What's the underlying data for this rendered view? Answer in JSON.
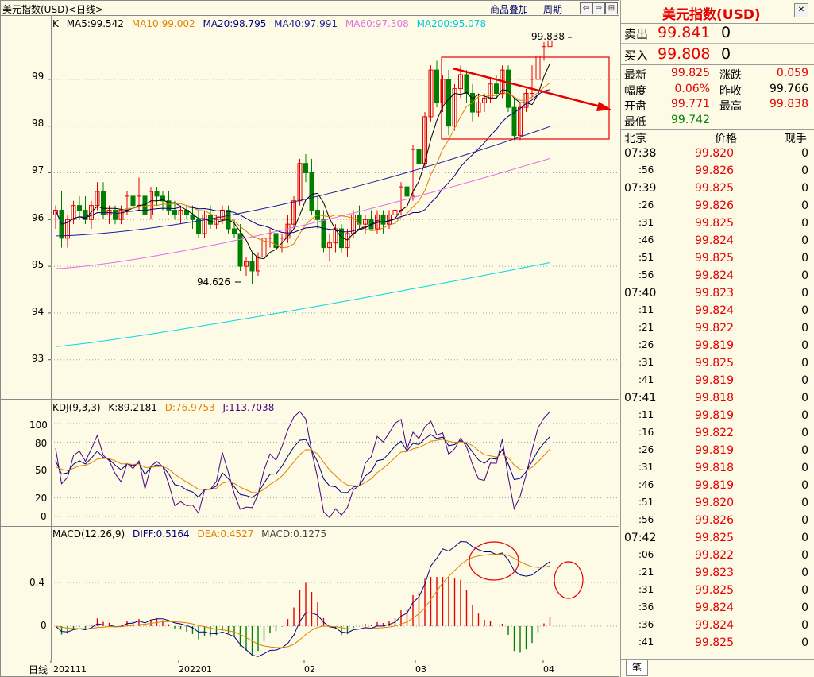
{
  "header": {
    "title": "美元指数(USD)<日线>",
    "links": {
      "overlay": "商品叠加",
      "period": "周期"
    }
  },
  "main_legend": {
    "k": "K",
    "ma5": "MA5:99.542",
    "ma10": "MA10:99.002",
    "ma20": "MA20:98.795",
    "ma40": "MA40:97.991",
    "ma60": "MA60:97.308",
    "ma200": "MA200:95.078"
  },
  "price_axis": [
    "99",
    "98",
    "97",
    "96",
    "95",
    "94",
    "93"
  ],
  "annotations": {
    "high": "99.838",
    "low": "94.626"
  },
  "kdj_legend": {
    "name": "KDJ(9,3,3)",
    "k": "K:89.2181",
    "d": "D:76.9753",
    "j": "J:113.7038"
  },
  "kdj_axis": [
    "100",
    "80",
    "50",
    "20",
    "0"
  ],
  "macd_legend": {
    "name": "MACD(12,26,9)",
    "diff": "DIFF:0.5164",
    "dea": "DEA:0.4527",
    "macd": "MACD:0.1275"
  },
  "macd_axis": [
    "0.4",
    "0"
  ],
  "x_axis": {
    "period_label": "日线",
    "ticks": [
      "202111",
      "202201",
      "02",
      "03",
      "04"
    ]
  },
  "side": {
    "title": "美元指数(USD)",
    "sell": {
      "label": "卖出",
      "price": "99.841",
      "vol": "0"
    },
    "buy": {
      "label": "买入",
      "price": "99.808",
      "vol": "0"
    },
    "stats": [
      {
        "l1": "最新",
        "v1": "99.825",
        "l2": "涨跌",
        "v2": "0.059"
      },
      {
        "l1": "幅度",
        "v1": "0.06%",
        "l2": "昨收",
        "v2": "99.766"
      },
      {
        "l1": "开盘",
        "v1": "99.771",
        "l2": "最高",
        "v2": "99.838"
      },
      {
        "l1": "最低",
        "v1": "99.742",
        "l2": "",
        "v2": ""
      }
    ],
    "ticks_header": {
      "time": "北京",
      "price": "价格",
      "vol": "现手"
    },
    "ticks": [
      {
        "t": "07:38",
        "p": "99.820",
        "v": "0"
      },
      {
        "t": ":56",
        "p": "99.826",
        "v": "0"
      },
      {
        "t": "07:39",
        "p": "99.825",
        "v": "0"
      },
      {
        "t": ":26",
        "p": "99.826",
        "v": "0"
      },
      {
        "t": ":31",
        "p": "99.825",
        "v": "0"
      },
      {
        "t": ":46",
        "p": "99.824",
        "v": "0"
      },
      {
        "t": ":51",
        "p": "99.825",
        "v": "0"
      },
      {
        "t": ":56",
        "p": "99.824",
        "v": "0"
      },
      {
        "t": "07:40",
        "p": "99.823",
        "v": "0"
      },
      {
        "t": ":11",
        "p": "99.824",
        "v": "0"
      },
      {
        "t": ":21",
        "p": "99.822",
        "v": "0"
      },
      {
        "t": ":26",
        "p": "99.819",
        "v": "0"
      },
      {
        "t": ":31",
        "p": "99.825",
        "v": "0"
      },
      {
        "t": ":41",
        "p": "99.819",
        "v": "0"
      },
      {
        "t": "07:41",
        "p": "99.818",
        "v": "0"
      },
      {
        "t": ":11",
        "p": "99.819",
        "v": "0"
      },
      {
        "t": ":16",
        "p": "99.822",
        "v": "0"
      },
      {
        "t": ":26",
        "p": "99.819",
        "v": "0"
      },
      {
        "t": ":31",
        "p": "99.818",
        "v": "0"
      },
      {
        "t": ":46",
        "p": "99.819",
        "v": "0"
      },
      {
        "t": ":51",
        "p": "99.820",
        "v": "0"
      },
      {
        "t": ":56",
        "p": "99.826",
        "v": "0"
      },
      {
        "t": "07:42",
        "p": "99.825",
        "v": "0"
      },
      {
        "t": ":06",
        "p": "99.822",
        "v": "0"
      },
      {
        "t": ":21",
        "p": "99.823",
        "v": "0"
      },
      {
        "t": ":31",
        "p": "99.825",
        "v": "0"
      },
      {
        "t": ":36",
        "p": "99.824",
        "v": "0"
      },
      {
        "t": ":36",
        "p": "99.824",
        "v": "0"
      },
      {
        "t": ":41",
        "p": "99.825",
        "v": "0"
      }
    ],
    "bottom_tab": "笔"
  },
  "colors": {
    "up": "#e60000",
    "down": "#008000",
    "ma5": "#000000",
    "ma10": "#e08000",
    "ma20": "#000080",
    "ma40": "#1e1e9a",
    "ma60": "#e070e0",
    "ma200": "#00d8e8",
    "background": "#fdfbe6"
  },
  "chart_data": {
    "type": "candlestick",
    "y_range": [
      92.4,
      99.95
    ],
    "candles": [
      [
        96.1,
        96.3,
        95.8,
        96.2
      ],
      [
        96.2,
        96.6,
        95.4,
        95.6
      ],
      [
        95.6,
        96.1,
        95.4,
        96.0
      ],
      [
        96.0,
        96.4,
        95.9,
        96.3
      ],
      [
        96.3,
        96.5,
        96.0,
        96.2
      ],
      [
        96.2,
        96.5,
        95.9,
        96.0
      ],
      [
        96.0,
        96.4,
        95.8,
        96.3
      ],
      [
        96.3,
        96.8,
        96.2,
        96.6
      ],
      [
        96.6,
        96.8,
        96.0,
        96.1
      ],
      [
        96.1,
        96.3,
        95.9,
        96.2
      ],
      [
        96.2,
        96.3,
        95.9,
        96.0
      ],
      [
        96.0,
        96.3,
        95.9,
        96.2
      ],
      [
        96.2,
        96.6,
        96.1,
        96.5
      ],
      [
        96.5,
        96.7,
        96.2,
        96.3
      ],
      [
        96.3,
        96.9,
        96.2,
        96.5
      ],
      [
        96.5,
        96.6,
        96.0,
        96.1
      ],
      [
        96.1,
        96.7,
        96.0,
        96.6
      ],
      [
        96.6,
        96.7,
        96.3,
        96.5
      ],
      [
        96.5,
        96.6,
        96.2,
        96.4
      ],
      [
        96.4,
        96.6,
        96.1,
        96.2
      ],
      [
        96.2,
        96.4,
        96.0,
        96.1
      ],
      [
        96.1,
        96.3,
        95.9,
        96.2
      ],
      [
        96.2,
        96.3,
        96.0,
        96.1
      ],
      [
        96.1,
        96.3,
        95.8,
        96.0
      ],
      [
        96.0,
        96.2,
        95.6,
        95.7
      ],
      [
        95.7,
        96.2,
        95.6,
        96.1
      ],
      [
        96.1,
        96.3,
        95.8,
        95.9
      ],
      [
        95.9,
        96.1,
        95.8,
        96.0
      ],
      [
        96.0,
        96.3,
        95.9,
        96.2
      ],
      [
        96.2,
        96.3,
        95.7,
        95.8
      ],
      [
        95.8,
        96.0,
        95.6,
        95.7
      ],
      [
        95.7,
        95.9,
        94.9,
        95.0
      ],
      [
        95.0,
        95.2,
        94.8,
        95.1
      ],
      [
        95.1,
        95.3,
        94.626,
        94.9
      ],
      [
        94.9,
        95.3,
        94.8,
        95.2
      ],
      [
        95.2,
        95.7,
        95.1,
        95.6
      ],
      [
        95.6,
        95.8,
        95.4,
        95.7
      ],
      [
        95.7,
        95.8,
        95.3,
        95.4
      ],
      [
        95.4,
        95.7,
        95.3,
        95.6
      ],
      [
        95.6,
        96.1,
        95.5,
        95.9
      ],
      [
        95.9,
        96.5,
        95.8,
        96.4
      ],
      [
        96.4,
        97.3,
        96.3,
        97.2
      ],
      [
        97.2,
        97.4,
        96.8,
        97.0
      ],
      [
        97.0,
        97.3,
        96.1,
        96.2
      ],
      [
        96.2,
        96.5,
        95.8,
        96.0
      ],
      [
        96.0,
        96.2,
        95.3,
        95.4
      ],
      [
        95.4,
        95.7,
        95.1,
        95.5
      ],
      [
        95.5,
        95.9,
        95.3,
        95.8
      ],
      [
        95.8,
        95.9,
        95.3,
        95.4
      ],
      [
        95.4,
        95.8,
        95.2,
        95.7
      ],
      [
        95.7,
        96.2,
        95.6,
        96.1
      ],
      [
        96.1,
        96.3,
        95.8,
        95.9
      ],
      [
        95.9,
        96.1,
        95.7,
        96.0
      ],
      [
        96.0,
        96.2,
        95.8,
        95.8
      ],
      [
        95.8,
        96.2,
        95.7,
        96.1
      ],
      [
        96.1,
        96.2,
        95.7,
        95.9
      ],
      [
        95.9,
        96.2,
        95.8,
        96.1
      ],
      [
        96.1,
        96.3,
        95.9,
        96.2
      ],
      [
        96.2,
        96.8,
        96.1,
        96.7
      ],
      [
        96.7,
        97.3,
        96.5,
        96.5
      ],
      [
        96.5,
        97.6,
        96.4,
        97.5
      ],
      [
        97.5,
        97.7,
        97.0,
        97.2
      ],
      [
        97.2,
        98.3,
        97.1,
        98.2
      ],
      [
        98.2,
        99.3,
        98.1,
        99.2
      ],
      [
        99.2,
        99.4,
        98.4,
        98.5
      ],
      [
        98.5,
        99.1,
        98.3,
        99.0
      ],
      [
        99.0,
        99.2,
        97.8,
        98.0
      ],
      [
        98.0,
        98.9,
        97.9,
        98.8
      ],
      [
        98.8,
        99.3,
        98.6,
        99.1
      ],
      [
        99.1,
        99.2,
        98.5,
        98.7
      ],
      [
        98.7,
        98.9,
        98.1,
        98.3
      ],
      [
        98.3,
        98.7,
        98.2,
        98.5
      ],
      [
        98.5,
        98.7,
        98.3,
        98.6
      ],
      [
        98.6,
        99.0,
        98.5,
        98.9
      ],
      [
        98.9,
        99.1,
        98.6,
        98.7
      ],
      [
        98.7,
        99.3,
        98.6,
        99.2
      ],
      [
        99.2,
        99.3,
        98.3,
        98.4
      ],
      [
        98.4,
        98.6,
        97.7,
        97.8
      ],
      [
        97.8,
        98.5,
        97.7,
        98.4
      ],
      [
        98.4,
        98.8,
        98.3,
        98.7
      ],
      [
        98.7,
        99.3,
        98.6,
        99.0
      ],
      [
        99.0,
        99.6,
        98.9,
        99.5
      ],
      [
        99.5,
        99.8,
        99.4,
        99.7
      ],
      [
        99.7,
        99.838,
        99.742,
        99.825
      ]
    ],
    "ma_levels": {
      "ma5": 99.542,
      "ma10": 99.002,
      "ma20": 98.795,
      "ma40": 97.991,
      "ma60": 97.308,
      "ma200": 95.078
    },
    "kdj": {
      "k": 89.2181,
      "d": 76.9753,
      "j": 113.7038
    },
    "macd": {
      "diff": 0.5164,
      "dea": 0.4527,
      "macd": 0.1275
    }
  }
}
